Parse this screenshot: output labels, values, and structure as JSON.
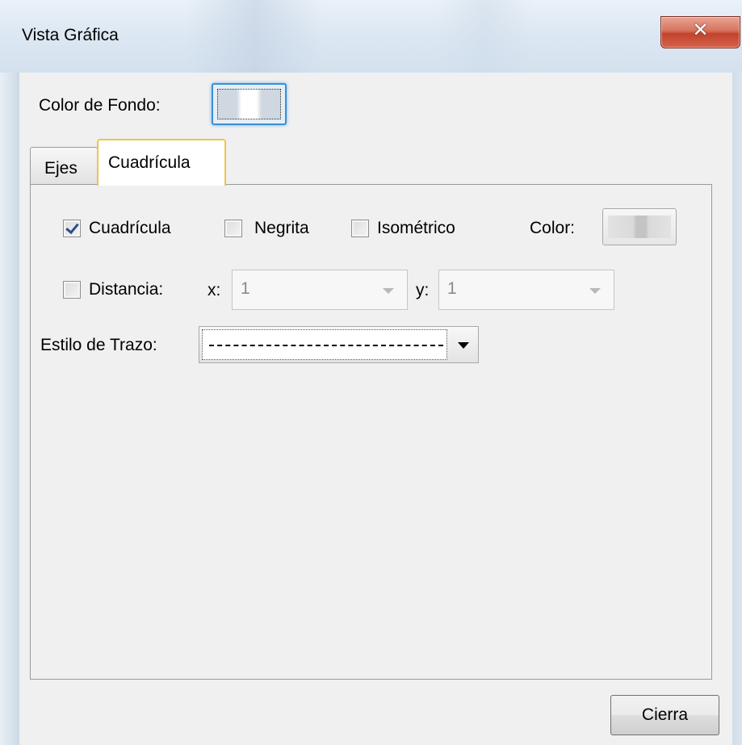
{
  "window": {
    "title": "Vista Gráfica",
    "close_glyph": "✕"
  },
  "background": {
    "label": "Color de Fondo:",
    "color": "#ffffff"
  },
  "tabs": [
    {
      "label": "Ejes",
      "selected": false
    },
    {
      "label": "Cuadrícula",
      "selected": true
    }
  ],
  "grid_tab": {
    "show_grid": {
      "label": "Cuadrícula",
      "checked": true
    },
    "bold": {
      "label": "Negrita",
      "checked": false
    },
    "isometric": {
      "label": "Isométrico",
      "checked": false
    },
    "color_label": "Color:",
    "grid_color": "#c4c4c4",
    "distance": {
      "label": "Distancia:",
      "checked": false,
      "x_label": "x:",
      "x_value": "1",
      "y_label": "y:",
      "y_value": "1"
    },
    "line_style": {
      "label": "Estilo de Trazo:",
      "selected": "dashed"
    }
  },
  "footer": {
    "close_label": "Cierra"
  }
}
